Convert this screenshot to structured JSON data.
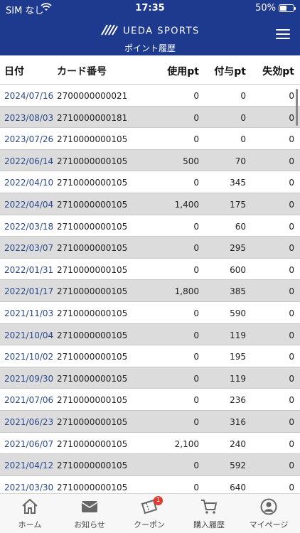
{
  "status_bar": {
    "carrier": "SIM なし",
    "time": "17:35",
    "battery": "50%"
  },
  "header": {
    "brand": "UEDA SPORTS",
    "subtitle": "ポイント履歴"
  },
  "columns": {
    "date": "日付",
    "card": "カード番号",
    "used": "使用pt",
    "given": "付与pt",
    "expired": "失効pt"
  },
  "rows": [
    {
      "date": "2024/07/16",
      "card": "2700000000021",
      "used": "0",
      "given": "0",
      "expired": "0"
    },
    {
      "date": "2023/08/03",
      "card": "2710000000181",
      "used": "0",
      "given": "0",
      "expired": "0"
    },
    {
      "date": "2023/07/26",
      "card": "2710000000105",
      "used": "0",
      "given": "0",
      "expired": "0"
    },
    {
      "date": "2022/06/14",
      "card": "2710000000105",
      "used": "500",
      "given": "70",
      "expired": "0"
    },
    {
      "date": "2022/04/10",
      "card": "2710000000105",
      "used": "0",
      "given": "345",
      "expired": "0"
    },
    {
      "date": "2022/04/04",
      "card": "2710000000105",
      "used": "1,400",
      "given": "175",
      "expired": "0"
    },
    {
      "date": "2022/03/18",
      "card": "2710000000105",
      "used": "0",
      "given": "60",
      "expired": "0"
    },
    {
      "date": "2022/03/07",
      "card": "2710000000105",
      "used": "0",
      "given": "295",
      "expired": "0"
    },
    {
      "date": "2022/01/31",
      "card": "2710000000105",
      "used": "0",
      "given": "600",
      "expired": "0"
    },
    {
      "date": "2022/01/17",
      "card": "2710000000105",
      "used": "1,800",
      "given": "385",
      "expired": "0"
    },
    {
      "date": "2021/11/03",
      "card": "2710000000105",
      "used": "0",
      "given": "590",
      "expired": "0"
    },
    {
      "date": "2021/10/04",
      "card": "2710000000105",
      "used": "0",
      "given": "119",
      "expired": "0"
    },
    {
      "date": "2021/10/02",
      "card": "2710000000105",
      "used": "0",
      "given": "195",
      "expired": "0"
    },
    {
      "date": "2021/09/30",
      "card": "2710000000105",
      "used": "0",
      "given": "119",
      "expired": "0"
    },
    {
      "date": "2021/07/06",
      "card": "2710000000105",
      "used": "0",
      "given": "236",
      "expired": "0"
    },
    {
      "date": "2021/06/23",
      "card": "2710000000105",
      "used": "0",
      "given": "316",
      "expired": "0"
    },
    {
      "date": "2021/06/07",
      "card": "2710000000105",
      "used": "2,100",
      "given": "240",
      "expired": "0"
    },
    {
      "date": "2021/04/12",
      "card": "2710000000105",
      "used": "0",
      "given": "592",
      "expired": "0"
    },
    {
      "date": "2021/03/30",
      "card": "2710000000105",
      "used": "0",
      "given": "640",
      "expired": "0"
    }
  ],
  "tabbar": {
    "tabs": [
      {
        "label": "ホーム",
        "icon": "home-icon"
      },
      {
        "label": "お知らせ",
        "icon": "mail-icon"
      },
      {
        "label": "クーポン",
        "icon": "coupon-icon",
        "badge": "1"
      },
      {
        "label": "購入履歴",
        "icon": "cart-icon"
      },
      {
        "label": "マイページ",
        "icon": "user-icon"
      }
    ]
  },
  "colors": {
    "header": "#1d3a8f",
    "date_text": "#2b4a8a",
    "row_alt": "#dcdcdc",
    "badge": "#e23a2f"
  }
}
